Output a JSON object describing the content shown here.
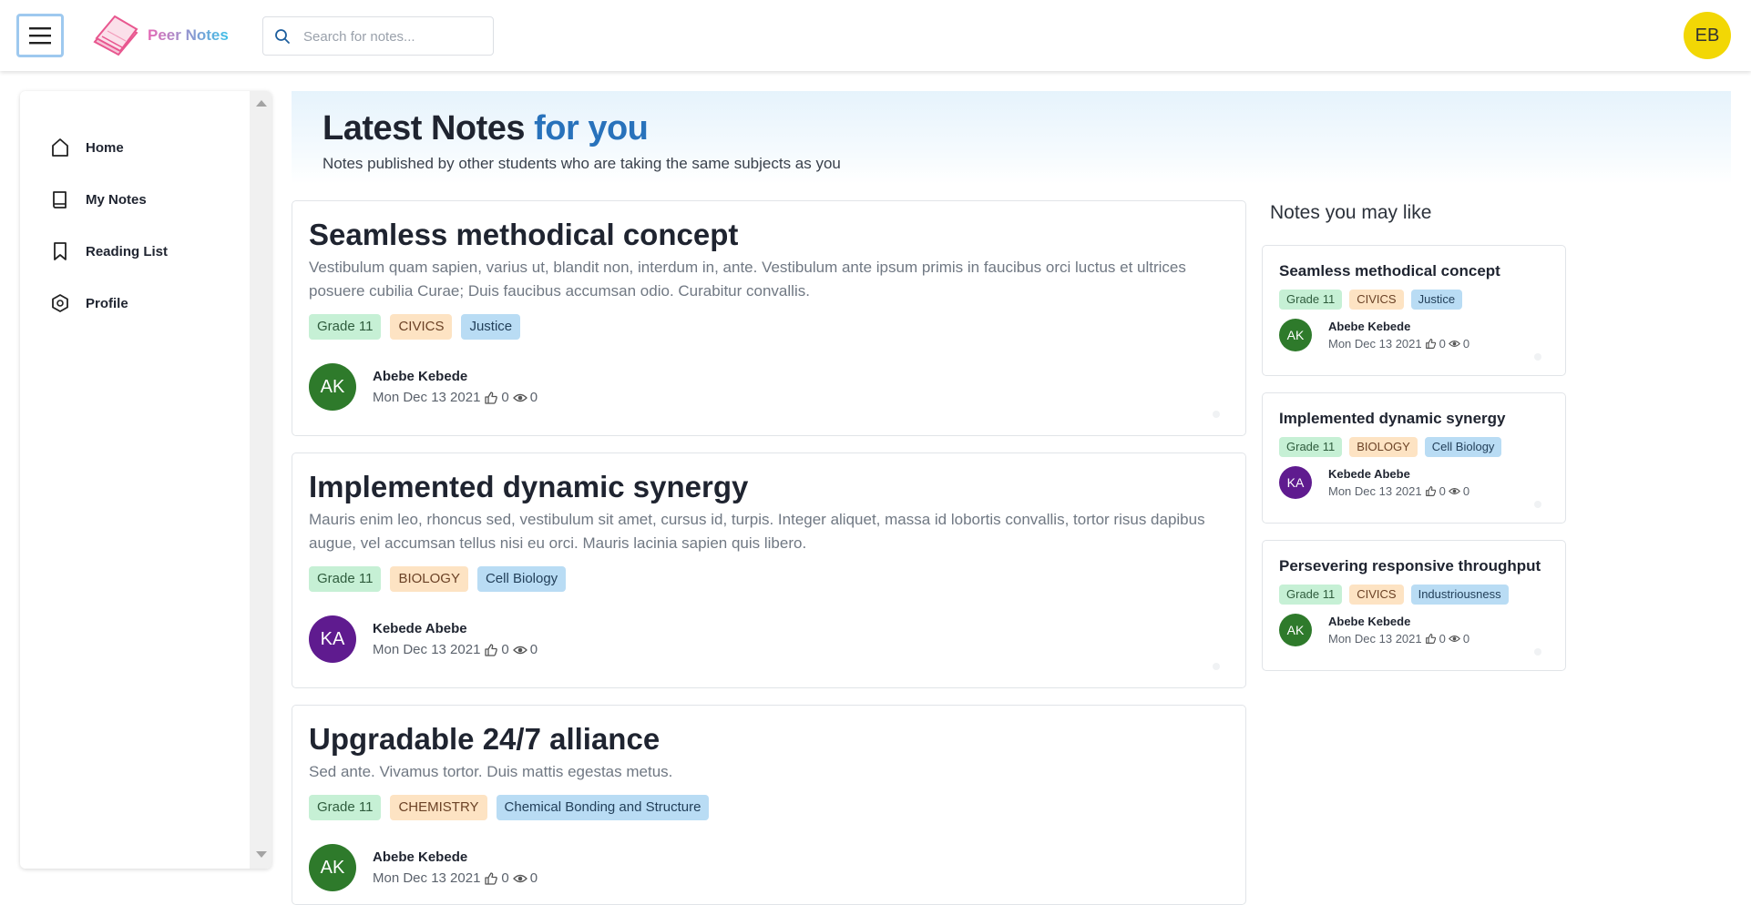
{
  "header": {
    "brand": "Peer Notes",
    "search_placeholder": "Search for notes...",
    "user_initials": "EB"
  },
  "sidebar": {
    "items": [
      {
        "label": "Home",
        "icon": "home-icon"
      },
      {
        "label": "My Notes",
        "icon": "book-icon"
      },
      {
        "label": "Reading List",
        "icon": "bookmark-icon"
      },
      {
        "label": "Profile",
        "icon": "hexagon-icon"
      }
    ]
  },
  "hero": {
    "title": "Latest Notes",
    "title_accent": "for you",
    "subtitle": "Notes published by other students who are taking the same subjects as you"
  },
  "notes": [
    {
      "title": "Seamless methodical concept",
      "description": "Vestibulum quam sapien, varius ut, blandit non, interdum in, ante. Vestibulum ante ipsum primis in faucibus orci luctus et ultrices posuere cubilia Curae; Duis faucibus accumsan odio. Curabitur convallis.",
      "tags": [
        "Grade 11",
        "CIVICS",
        "Justice"
      ],
      "author_initials": "AK",
      "author": "Abebe Kebede",
      "date": "Mon Dec 13 2021",
      "likes": "0",
      "views": "0"
    },
    {
      "title": "Implemented dynamic synergy",
      "description": "Mauris enim leo, rhoncus sed, vestibulum sit amet, cursus id, turpis. Integer aliquet, massa id lobortis convallis, tortor risus dapibus augue, vel accumsan tellus nisi eu orci. Mauris lacinia sapien quis libero.",
      "tags": [
        "Grade 11",
        "BIOLOGY",
        "Cell Biology"
      ],
      "author_initials": "KA",
      "author": "Kebede Abebe",
      "date": "Mon Dec 13 2021",
      "likes": "0",
      "views": "0"
    },
    {
      "title": "Upgradable 24/7 alliance",
      "description": "Sed ante. Vivamus tortor. Duis mattis egestas metus.",
      "tags": [
        "Grade 11",
        "CHEMISTRY",
        "Chemical Bonding and Structure"
      ],
      "author_initials": "AK",
      "author": "Abebe Kebede",
      "date": "Mon Dec 13 2021",
      "likes": "0",
      "views": "0"
    }
  ],
  "recommended": {
    "heading": "Notes you may like",
    "items": [
      {
        "title": "Seamless methodical concept",
        "tags": [
          "Grade 11",
          "CIVICS",
          "Justice"
        ],
        "author_initials": "AK",
        "author": "Abebe Kebede",
        "date": "Mon Dec 13 2021",
        "likes": "0",
        "views": "0"
      },
      {
        "title": "Implemented dynamic synergy",
        "tags": [
          "Grade 11",
          "BIOLOGY",
          "Cell Biology"
        ],
        "author_initials": "KA",
        "author": "Kebede Abebe",
        "date": "Mon Dec 13 2021",
        "likes": "0",
        "views": "0"
      },
      {
        "title": "Persevering responsive throughput",
        "tags": [
          "Grade 11",
          "CIVICS",
          "Industriousness"
        ],
        "author_initials": "AK",
        "author": "Abebe Kebede",
        "date": "Mon Dec 13 2021",
        "likes": "0",
        "views": "0"
      }
    ]
  },
  "colors": {
    "accent": "#2872bb",
    "user_avatar": "#f2d705",
    "avatar_ak": "#2e7a2b",
    "avatar_ka": "#5f1b8f",
    "tag_grade": "#c6f0d5",
    "tag_subject": "#fde3c3",
    "tag_topic": "#b9dcf4"
  }
}
